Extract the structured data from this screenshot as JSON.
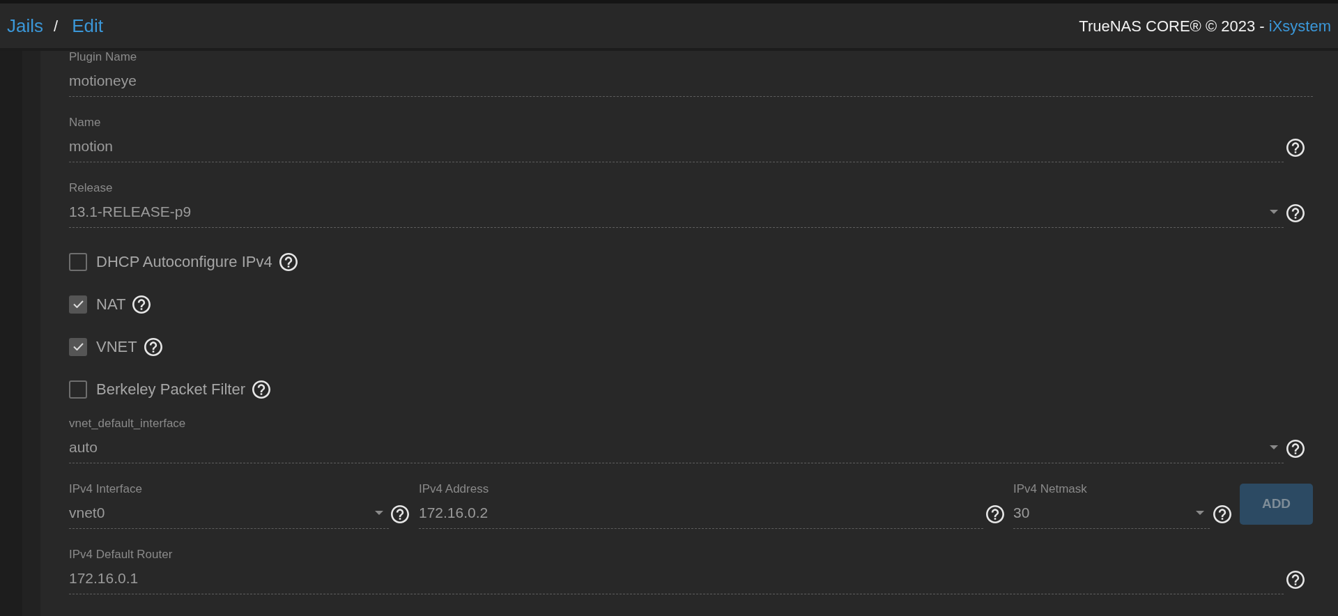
{
  "header": {
    "breadcrumb": [
      {
        "label": "Jails"
      },
      {
        "label": "Edit"
      }
    ],
    "separator": "/",
    "copyright": "TrueNAS CORE® © 2023 - ",
    "vendor_link": "iXsystem"
  },
  "form": [
    {
      "kind": "text",
      "label": "Plugin Name",
      "value": "motioneye",
      "help": false
    },
    {
      "kind": "text",
      "label": "Name",
      "value": "motion",
      "help": true
    },
    {
      "kind": "select",
      "label": "Release",
      "value": "13.1-RELEASE-p9",
      "help": true
    },
    {
      "kind": "checkbox",
      "label": "DHCP Autoconfigure IPv4",
      "checked": false,
      "help": true
    },
    {
      "kind": "checkbox",
      "label": "NAT",
      "checked": true,
      "help": true
    },
    {
      "kind": "checkbox",
      "label": "VNET",
      "checked": true,
      "help": true
    },
    {
      "kind": "checkbox",
      "label": "Berkeley Packet Filter",
      "checked": false,
      "help": true
    },
    {
      "kind": "select",
      "label": "vnet_default_interface",
      "value": "auto",
      "help": true
    },
    {
      "kind": "group",
      "fields": [
        {
          "kind": "select",
          "label": "IPv4 Interface",
          "value": "vnet0",
          "help": true
        },
        {
          "kind": "text",
          "label": "IPv4 Address",
          "value": "172.16.0.2",
          "help": true
        },
        {
          "kind": "select",
          "label": "IPv4 Netmask",
          "value": "30",
          "help": true
        }
      ],
      "button": {
        "label": "ADD",
        "disabled": true
      }
    },
    {
      "kind": "text",
      "label": "IPv4 Default Router",
      "value": "172.16.0.1",
      "help": true
    }
  ]
}
